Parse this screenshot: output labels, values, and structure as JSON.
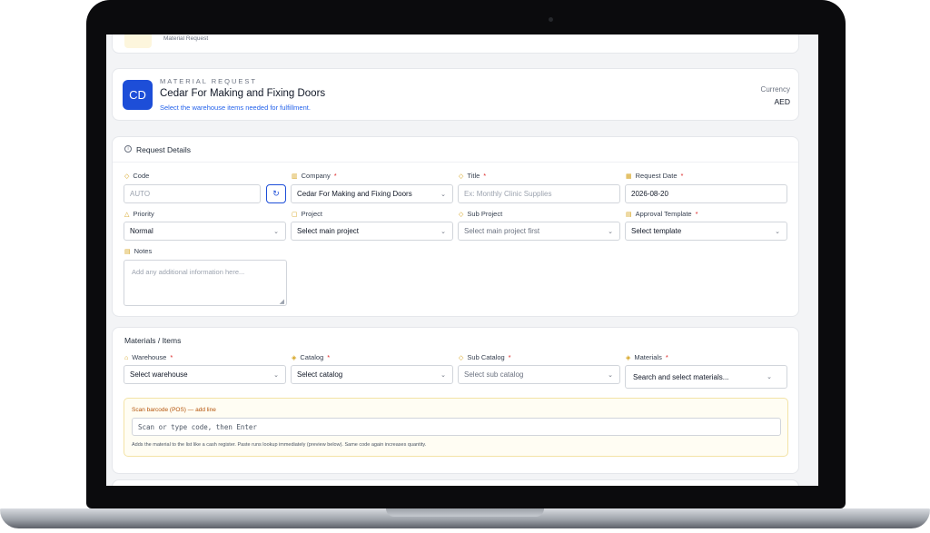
{
  "header_strip": {
    "label": "Material Request"
  },
  "request_card": {
    "avatar": "CD",
    "eyebrow": "MATERIAL REQUEST",
    "title": "Cedar For Making and Fixing Doors",
    "subtitle": "Select the warehouse items needed for fulfillment.",
    "currency_label": "Currency",
    "currency_value": "AED"
  },
  "details": {
    "heading": "Request Details",
    "code": {
      "label": "Code",
      "placeholder": "AUTO"
    },
    "company": {
      "label": "Company",
      "value": "Cedar For Making and Fixing Doors"
    },
    "title": {
      "label": "Title",
      "placeholder": "Ex: Monthly Clinic Supplies"
    },
    "request_date": {
      "label": "Request Date",
      "value": "2026-08-20"
    },
    "priority": {
      "label": "Priority",
      "value": "Normal"
    },
    "project": {
      "label": "Project",
      "value": "Select main project"
    },
    "sub_project": {
      "label": "Sub Project",
      "value": "Select main project first"
    },
    "approval_template": {
      "label": "Approval Template",
      "value": "Select template"
    },
    "notes": {
      "label": "Notes",
      "placeholder": "Add any additional information here..."
    }
  },
  "materials": {
    "heading": "Materials / Items",
    "warehouse": {
      "label": "Warehouse",
      "value": "Select warehouse"
    },
    "catalog": {
      "label": "Catalog",
      "value": "Select catalog"
    },
    "sub_catalog": {
      "label": "Sub Catalog",
      "value": "Select sub catalog"
    },
    "materials": {
      "label": "Materials",
      "value": "Search and select materials..."
    },
    "scan": {
      "title": "Scan barcode (POS) — add line",
      "placeholder": "Scan or type code, then Enter",
      "help": "Adds the material to the list like a cash register. Paste runs lookup immediately (preview below). Same code again increases quantity."
    }
  },
  "required_marker": "*"
}
